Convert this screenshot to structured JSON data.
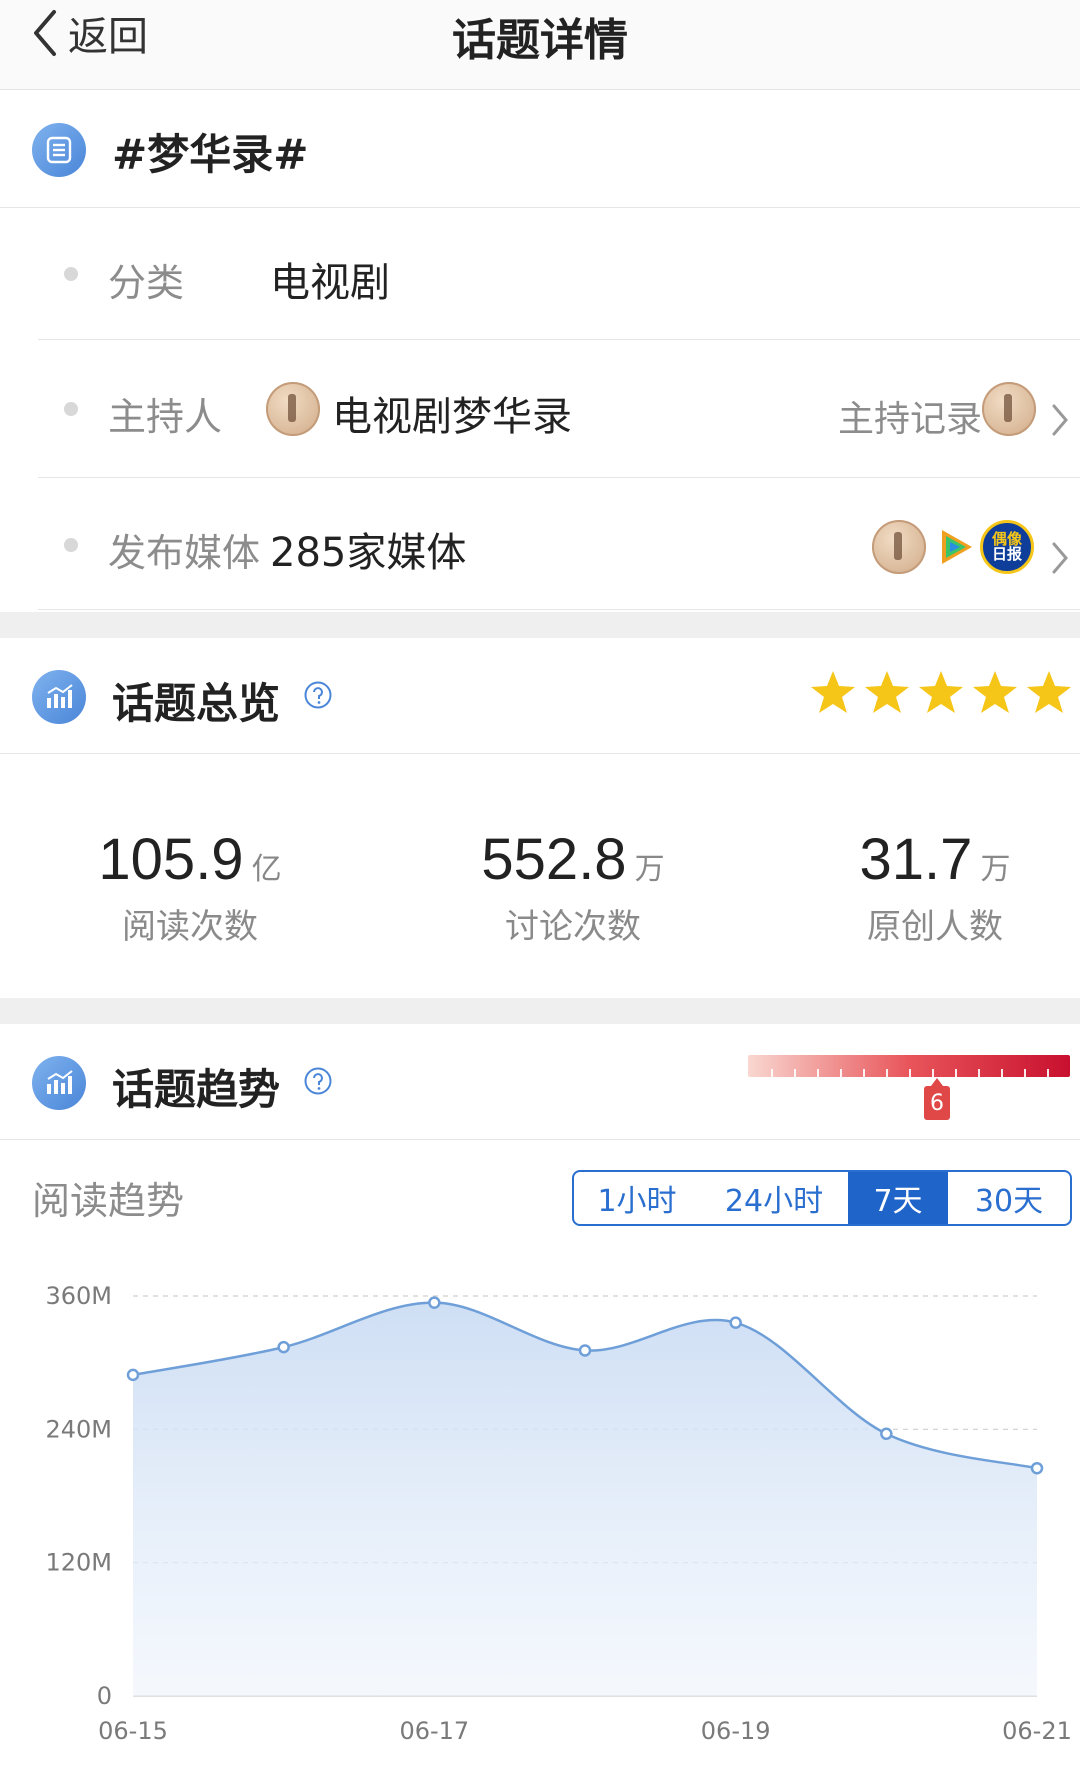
{
  "nav": {
    "back_label": "返回",
    "title": "话题详情"
  },
  "topic": {
    "title": "#梦华录#",
    "icon": "list-doc-icon"
  },
  "info": {
    "category_label": "分类",
    "category_value": "电视剧",
    "host_label": "主持人",
    "host_name": "电视剧梦华录",
    "host_record_label": "主持记录",
    "media_label": "发布媒体",
    "media_value": "285家媒体",
    "media_icons": [
      "menghualu-avatar",
      "video-play-icon",
      "idol-daily-icon"
    ],
    "media_icon_texts": [
      "偶像",
      "日报"
    ]
  },
  "overview": {
    "title": "话题总览",
    "rating_stars": 5,
    "stats": [
      {
        "value": "105.9",
        "unit": "亿",
        "label": "阅读次数"
      },
      {
        "value": "552.8",
        "unit": "万",
        "label": "讨论次数"
      },
      {
        "value": "31.7",
        "unit": "万",
        "label": "原创人数"
      }
    ]
  },
  "trend": {
    "title": "话题趋势",
    "heat_level": "6",
    "sub_label": "阅读趋势",
    "ranges": [
      "1小时",
      "24小时",
      "7天",
      "30天"
    ],
    "active_range": "7天"
  },
  "colors": {
    "accent": "#1f64c8",
    "star": "#f5c518",
    "line": "#6f9fd8",
    "heat": "#e04848"
  },
  "chart_data": {
    "type": "area",
    "title": "",
    "xlabel": "",
    "ylabel": "",
    "x": [
      "06-15",
      "06-16",
      "06-17",
      "06-18",
      "06-19",
      "06-20",
      "06-21"
    ],
    "x_tick_labels": [
      "06-15",
      "06-17",
      "06-19",
      "06-21"
    ],
    "values": [
      289,
      314,
      354,
      311,
      336,
      236,
      205
    ],
    "value_unit": "M",
    "y_ticks": [
      0,
      120,
      240,
      360
    ],
    "y_tick_labels": [
      "0",
      "120M",
      "240M",
      "360M"
    ],
    "ylim": [
      0,
      360
    ],
    "grid": "horizontal dashed",
    "legend": "none"
  }
}
